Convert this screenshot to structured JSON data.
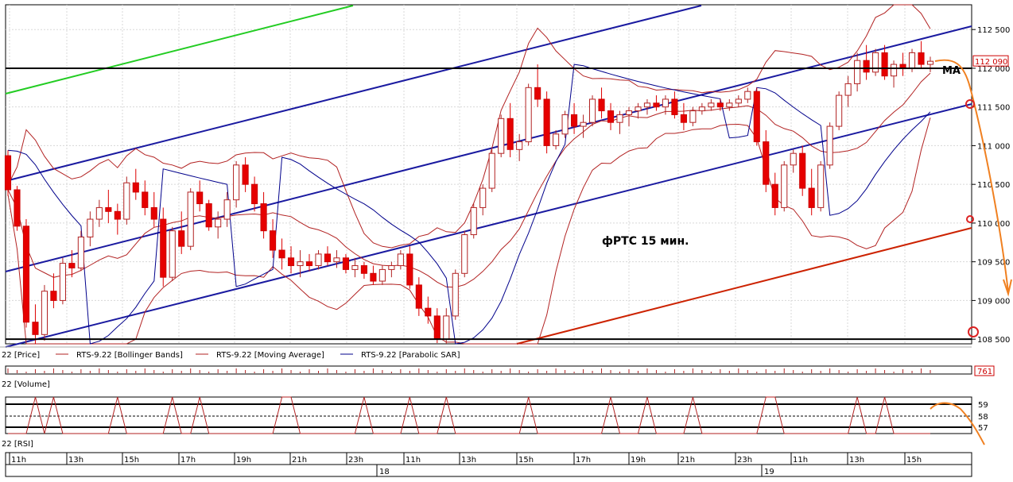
{
  "chart_data": {
    "type": "candlestick",
    "annotation": "фРТС   15 мин.",
    "ma_label": "MA",
    "price_axis": {
      "ticks": [
        108500,
        109000,
        109500,
        110000,
        110500,
        111000,
        111500,
        112000,
        112500
      ],
      "tick_labels": [
        "108 500",
        "109 000",
        "109 500",
        "110 000",
        "110 500",
        "111 000",
        "111 500",
        "112 000",
        "112 500"
      ],
      "range": [
        108440,
        112820
      ]
    },
    "last_price_label": "112 090",
    "last_price": 112090,
    "horizontal_levels": [
      112000,
      108500
    ],
    "legend": [
      {
        "label": "22 [Price]"
      },
      {
        "label": "RTS-9.22 [Bollinger Bands]",
        "color": "#b22222"
      },
      {
        "label": "RTS-9.22 [Moving Average]",
        "color": "#b22222"
      },
      {
        "label": "RTS-9.22 [Parabolic SAR]",
        "color": "#00008b"
      }
    ],
    "volume_panel": {
      "label": "22 [Volume]",
      "value_label": "761"
    },
    "rsi_panel": {
      "label": "22 [RSI]",
      "ticks": [
        "59",
        "58",
        "57"
      ]
    },
    "time_axis": {
      "hour_labels": [
        "11h",
        "13h",
        "15h",
        "17h",
        "19h",
        "21h",
        "23h",
        "11h",
        "13h",
        "15h",
        "17h",
        "19h",
        "21h",
        "23h",
        "11h",
        "13h",
        "15h"
      ],
      "day_labels": [
        "18",
        "19"
      ]
    },
    "candles": [
      [
        110870,
        110940,
        110350,
        110430
      ],
      [
        110430,
        110480,
        109900,
        109960
      ],
      [
        109960,
        110050,
        108650,
        108720
      ],
      [
        108720,
        108950,
        108440,
        108560
      ],
      [
        108560,
        109200,
        108480,
        109120
      ],
      [
        109120,
        109350,
        108900,
        109000
      ],
      [
        109000,
        109550,
        108950,
        109480
      ],
      [
        109480,
        109650,
        109300,
        109420
      ],
      [
        109420,
        109900,
        109380,
        109820
      ],
      [
        109820,
        110150,
        109700,
        110050
      ],
      [
        110050,
        110300,
        109950,
        110200
      ],
      [
        110200,
        110430,
        110000,
        110150
      ],
      [
        110150,
        110250,
        109850,
        110050
      ],
      [
        110050,
        110600,
        109980,
        110520
      ],
      [
        110520,
        110700,
        110300,
        110400
      ],
      [
        110400,
        110550,
        110100,
        110200
      ],
      [
        110200,
        110400,
        109950,
        110050
      ],
      [
        110050,
        110200,
        109180,
        109300
      ],
      [
        109300,
        109950,
        109250,
        109900
      ],
      [
        109900,
        110150,
        109600,
        109700
      ],
      [
        109700,
        110450,
        109650,
        110400
      ],
      [
        110400,
        110550,
        110150,
        110250
      ],
      [
        110250,
        110300,
        109900,
        109950
      ],
      [
        109950,
        110150,
        109800,
        110050
      ],
      [
        110050,
        110400,
        109950,
        110300
      ],
      [
        110300,
        110800,
        110200,
        110750
      ],
      [
        110750,
        110850,
        110400,
        110500
      ],
      [
        110500,
        110600,
        110150,
        110250
      ],
      [
        110250,
        110400,
        109800,
        109900
      ],
      [
        109900,
        110050,
        109550,
        109650
      ],
      [
        109650,
        109800,
        109400,
        109550
      ],
      [
        109550,
        109700,
        109350,
        109450
      ],
      [
        109450,
        109650,
        109300,
        109500
      ],
      [
        109500,
        109600,
        109380,
        109450
      ],
      [
        109450,
        109650,
        109400,
        109600
      ],
      [
        109600,
        109700,
        109450,
        109500
      ],
      [
        109500,
        109650,
        109420,
        109550
      ],
      [
        109550,
        109600,
        109350,
        109400
      ],
      [
        109400,
        109550,
        109300,
        109450
      ],
      [
        109450,
        109500,
        109280,
        109350
      ],
      [
        109350,
        109450,
        109200,
        109250
      ],
      [
        109250,
        109450,
        109200,
        109400
      ],
      [
        109400,
        109500,
        109300,
        109450
      ],
      [
        109450,
        109650,
        109400,
        109600
      ],
      [
        109600,
        109700,
        109150,
        109200
      ],
      [
        109200,
        109300,
        108800,
        108900
      ],
      [
        108900,
        109050,
        108700,
        108800
      ],
      [
        108800,
        108900,
        108450,
        108500
      ],
      [
        108500,
        108900,
        108440,
        108800
      ],
      [
        108800,
        109400,
        108750,
        109350
      ],
      [
        109350,
        109900,
        109300,
        109850
      ],
      [
        109850,
        110250,
        109800,
        110200
      ],
      [
        110200,
        110500,
        110100,
        110450
      ],
      [
        110450,
        110950,
        110400,
        110900
      ],
      [
        110900,
        111400,
        110850,
        111350
      ],
      [
        111350,
        111550,
        110850,
        110950
      ],
      [
        110950,
        111150,
        110800,
        111050
      ],
      [
        111050,
        111800,
        111000,
        111750
      ],
      [
        111750,
        112050,
        111500,
        111600
      ],
      [
        111600,
        111700,
        110900,
        111000
      ],
      [
        111000,
        111200,
        110950,
        111150
      ],
      [
        111150,
        111450,
        111100,
        111400
      ],
      [
        111400,
        111550,
        111150,
        111250
      ],
      [
        111250,
        111400,
        111100,
        111300
      ],
      [
        111300,
        111650,
        111250,
        111600
      ],
      [
        111600,
        111750,
        111350,
        111450
      ],
      [
        111450,
        111550,
        111200,
        111300
      ],
      [
        111300,
        111450,
        111150,
        111400
      ],
      [
        111400,
        111500,
        111250,
        111450
      ],
      [
        111450,
        111550,
        111350,
        111500
      ],
      [
        111500,
        111600,
        111400,
        111550
      ],
      [
        111550,
        111650,
        111450,
        111500
      ],
      [
        111500,
        111650,
        111400,
        111600
      ],
      [
        111600,
        111700,
        111350,
        111400
      ],
      [
        111400,
        111550,
        111200,
        111300
      ],
      [
        111300,
        111500,
        111250,
        111450
      ],
      [
        111450,
        111550,
        111400,
        111500
      ],
      [
        111500,
        111600,
        111450,
        111550
      ],
      [
        111550,
        111600,
        111450,
        111500
      ],
      [
        111500,
        111600,
        111450,
        111550
      ],
      [
        111550,
        111650,
        111500,
        111600
      ],
      [
        111600,
        111750,
        111550,
        111700
      ],
      [
        111700,
        111750,
        111000,
        111050
      ],
      [
        111050,
        111200,
        110400,
        110500
      ],
      [
        110500,
        110650,
        110100,
        110200
      ],
      [
        110200,
        110800,
        110150,
        110750
      ],
      [
        110750,
        110950,
        110650,
        110900
      ],
      [
        110900,
        111000,
        110350,
        110450
      ],
      [
        110450,
        110700,
        110100,
        110200
      ],
      [
        110200,
        110800,
        110150,
        110750
      ],
      [
        110750,
        111300,
        110700,
        111250
      ],
      [
        111250,
        111700,
        111200,
        111650
      ],
      [
        111650,
        111900,
        111500,
        111800
      ],
      [
        111800,
        112200,
        111700,
        112100
      ],
      [
        112100,
        112300,
        111850,
        111950
      ],
      [
        111950,
        112250,
        111900,
        112200
      ],
      [
        112200,
        112300,
        111850,
        111900
      ],
      [
        111900,
        112100,
        111750,
        112050
      ],
      [
        112050,
        112200,
        111900,
        112000
      ],
      [
        112000,
        112250,
        111950,
        112200
      ],
      [
        112200,
        112350,
        112000,
        112050
      ],
      [
        112050,
        112150,
        111950,
        112090
      ]
    ]
  }
}
